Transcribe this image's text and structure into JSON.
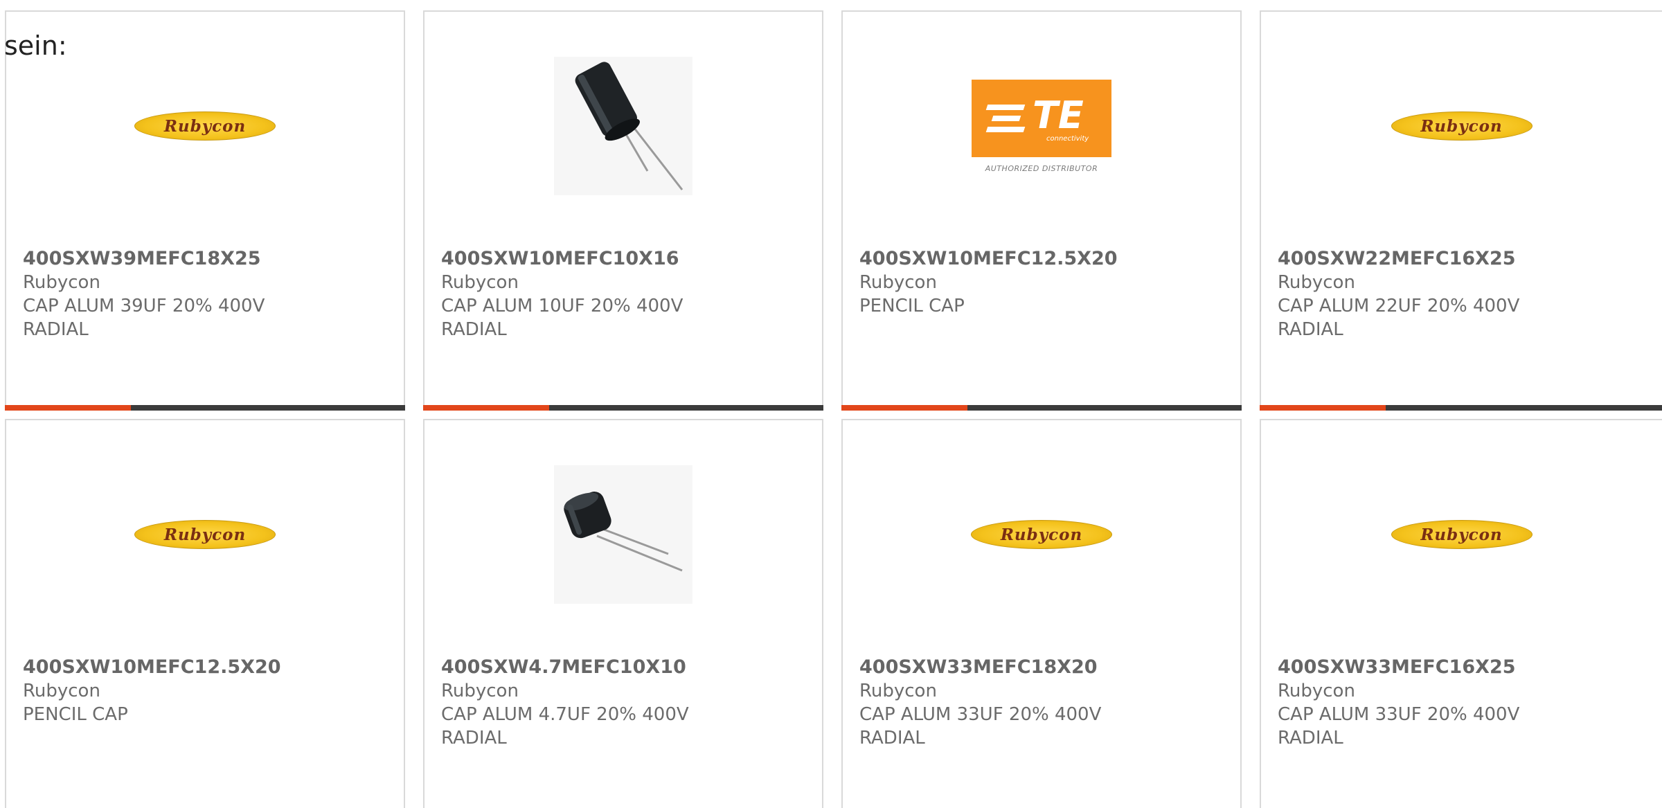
{
  "lead_text": "sein:",
  "products": [
    {
      "part": "400SXW39MEFC18X25",
      "manufacturer": "Rubycon",
      "desc1": "CAP ALUM 39UF 20% 400V",
      "desc2": "RADIAL",
      "image": "rubycon-logo",
      "logo_text": "Rubycon"
    },
    {
      "part": "400SXW10MEFC10X16",
      "manufacturer": "Rubycon",
      "desc1": "CAP ALUM 10UF 20% 400V",
      "desc2": "RADIAL",
      "image": "capacitor-tall-photo"
    },
    {
      "part": "400SXW10MEFC12.5X20",
      "manufacturer": "Rubycon",
      "desc1": "PENCIL CAP",
      "desc2": "",
      "image": "te-connectivity-logo",
      "logo_text": "TE",
      "logo_sub": "connectivity",
      "logo_caption": "AUTHORIZED DISTRIBUTOR"
    },
    {
      "part": "400SXW22MEFC16X25",
      "manufacturer": "Rubycon",
      "desc1": "CAP ALUM 22UF 20% 400V",
      "desc2": "RADIAL",
      "image": "rubycon-logo",
      "logo_text": "Rubycon"
    },
    {
      "part": "400SXW10MEFC12.5X20",
      "manufacturer": "Rubycon",
      "desc1": "PENCIL CAP",
      "desc2": "",
      "image": "rubycon-logo",
      "logo_text": "Rubycon"
    },
    {
      "part": "400SXW4.7MEFC10X10",
      "manufacturer": "Rubycon",
      "desc1": "CAP ALUM 4.7UF 20% 400V",
      "desc2": "RADIAL",
      "image": "capacitor-short-photo"
    },
    {
      "part": "400SXW33MEFC18X20",
      "manufacturer": "Rubycon",
      "desc1": "CAP ALUM 33UF 20% 400V",
      "desc2": "RADIAL",
      "image": "rubycon-logo",
      "logo_text": "Rubycon"
    },
    {
      "part": "400SXW33MEFC16X25",
      "manufacturer": "Rubycon",
      "desc1": "CAP ALUM 33UF 20% 400V",
      "desc2": "RADIAL",
      "image": "rubycon-logo",
      "logo_text": "Rubycon"
    }
  ],
  "colors": {
    "accent": "#e2461a",
    "bar": "#3b3b3b",
    "border": "#d9d9d9",
    "text": "#6b6b6b"
  }
}
